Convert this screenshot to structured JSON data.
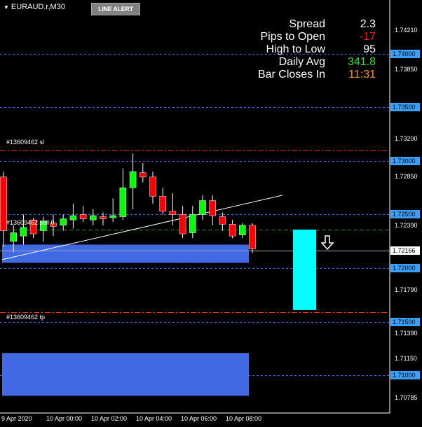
{
  "header": {
    "symbol": "EURAUD.r,M30",
    "line_alert_button": "LINE ALERT"
  },
  "info_panel": [
    {
      "label": "Spread",
      "value": "2.3",
      "color": "#ffffff"
    },
    {
      "label": "Pips to Open",
      "value": "-17",
      "color": "#ff1a1a"
    },
    {
      "label": "High to Low",
      "value": "95",
      "color": "#ffffff"
    },
    {
      "label": "Daily Avg",
      "value": "341.8",
      "color": "#33dd33"
    },
    {
      "label": "Bar Closes In",
      "value": "11:31",
      "color": "#ff9900"
    }
  ],
  "orders": {
    "sl_label": "#13609462 sl",
    "sell_label": "#13609462 sell 0",
    "tp_label": "#13609462 tp",
    "sl_price": 1.731,
    "sell_price": 1.7236,
    "tp_price": 1.7159
  },
  "price_axis": {
    "ticks": [
      "1.74210",
      "1.73850",
      "1.73500",
      "1.73200",
      "1.72850",
      "1.72390",
      "1.71790",
      "1.71390",
      "1.71150",
      "1.70785"
    ],
    "level_tags": [
      "1.74000",
      "1.73500",
      "1.73000",
      "1.72500",
      "1.72000",
      "1.71500",
      "1.71000"
    ],
    "current_price_tag": "1.72166",
    "current_price": 1.72166
  },
  "time_axis": [
    "9 Apr 2020",
    "10 Apr 00:00",
    "10 Apr 02:00",
    "10 Apr 04:00",
    "10 Apr 06:00",
    "10 Apr 08:00"
  ],
  "colors": {
    "background": "#000000",
    "bull": "#00ff00",
    "bear": "#ff0000",
    "level_line": "#4169e1",
    "zone_fill": "#4169e1",
    "projection_bar": "#00ffff",
    "order_line": "#ff3030",
    "entry_line": "#2e8b2e"
  },
  "chart_data": {
    "type": "candlestick",
    "symbol": "EURAUD.r",
    "timeframe": "M30",
    "ylim": [
      1.7065,
      1.745
    ],
    "candles": [
      {
        "o": 1.7285,
        "h": 1.729,
        "l": 1.722,
        "c": 1.7235
      },
      {
        "o": 1.7225,
        "h": 1.724,
        "l": 1.7215,
        "c": 1.7233
      },
      {
        "o": 1.723,
        "h": 1.725,
        "l": 1.7222,
        "c": 1.7238
      },
      {
        "o": 1.7245,
        "h": 1.7247,
        "l": 1.7228,
        "c": 1.7232
      },
      {
        "o": 1.7235,
        "h": 1.7248,
        "l": 1.7225,
        "c": 1.7244
      },
      {
        "o": 1.7242,
        "h": 1.725,
        "l": 1.723,
        "c": 1.7239
      },
      {
        "o": 1.724,
        "h": 1.725,
        "l": 1.7235,
        "c": 1.7246
      },
      {
        "o": 1.7245,
        "h": 1.726,
        "l": 1.7237,
        "c": 1.7249
      },
      {
        "o": 1.725,
        "h": 1.7258,
        "l": 1.7243,
        "c": 1.7246
      },
      {
        "o": 1.7245,
        "h": 1.7255,
        "l": 1.724,
        "c": 1.7249
      },
      {
        "o": 1.7248,
        "h": 1.7252,
        "l": 1.724,
        "c": 1.7246
      },
      {
        "o": 1.7247,
        "h": 1.7265,
        "l": 1.7243,
        "c": 1.7249
      },
      {
        "o": 1.7248,
        "h": 1.7293,
        "l": 1.7245,
        "c": 1.7275
      },
      {
        "o": 1.7275,
        "h": 1.7307,
        "l": 1.7255,
        "c": 1.729
      },
      {
        "o": 1.7289,
        "h": 1.7298,
        "l": 1.728,
        "c": 1.7285
      },
      {
        "o": 1.7285,
        "h": 1.729,
        "l": 1.726,
        "c": 1.7267
      },
      {
        "o": 1.7267,
        "h": 1.7275,
        "l": 1.725,
        "c": 1.7253
      },
      {
        "o": 1.7253,
        "h": 1.727,
        "l": 1.724,
        "c": 1.725
      },
      {
        "o": 1.725,
        "h": 1.7258,
        "l": 1.7228,
        "c": 1.7232
      },
      {
        "o": 1.7233,
        "h": 1.7258,
        "l": 1.7228,
        "c": 1.725
      },
      {
        "o": 1.725,
        "h": 1.7268,
        "l": 1.7245,
        "c": 1.7263
      },
      {
        "o": 1.7263,
        "h": 1.7268,
        "l": 1.724,
        "c": 1.7249
      },
      {
        "o": 1.7248,
        "h": 1.7252,
        "l": 1.7235,
        "c": 1.7241
      },
      {
        "o": 1.7241,
        "h": 1.7245,
        "l": 1.7228,
        "c": 1.723
      },
      {
        "o": 1.7231,
        "h": 1.7242,
        "l": 1.7228,
        "c": 1.724
      },
      {
        "o": 1.724,
        "h": 1.7242,
        "l": 1.7214,
        "c": 1.7218
      }
    ],
    "trendline": {
      "from": 1.7208,
      "to": 1.7268
    },
    "zones": [
      {
        "top": 1.7222,
        "bottom": 1.7205
      },
      {
        "top": 1.7121,
        "bottom": 1.7081
      }
    ],
    "projection": {
      "top": 1.7236,
      "bottom": 1.7161
    }
  }
}
